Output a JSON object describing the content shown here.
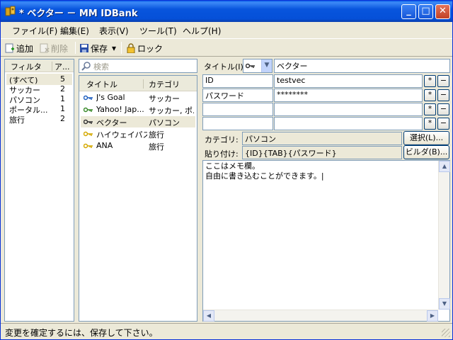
{
  "window": {
    "title": "* ベクター － MM IDBank",
    "minimize": "_",
    "maximize": "□",
    "close": "✕"
  },
  "menu": [
    {
      "label": "ファイル(F)"
    },
    {
      "label": "編集(E)"
    },
    {
      "label": "表示(V)"
    },
    {
      "label": "ツール(T)"
    },
    {
      "label": "ヘルプ(H)"
    }
  ],
  "toolbar": {
    "add": "追加",
    "delete": "削除",
    "save": "保存",
    "save_dropdown": "▾",
    "lock": "ロック"
  },
  "filter_panel": {
    "headers": [
      "フィルタ",
      "ア..."
    ],
    "rows": [
      {
        "name": "(すべて)",
        "count": "5"
      },
      {
        "name": "サッカー",
        "count": "2"
      },
      {
        "name": "パソコン",
        "count": "1"
      },
      {
        "name": "ポータル...",
        "count": "1"
      },
      {
        "name": "旅行",
        "count": "2"
      }
    ]
  },
  "search": {
    "placeholder": "検索"
  },
  "list_panel": {
    "headers": [
      "タイトル",
      "カテゴリ"
    ],
    "rows": [
      {
        "title": "J's Goal",
        "category": "サッカー",
        "key_color": "#1f5fbf"
      },
      {
        "title": "Yahoo! Jap...",
        "category": "サッカー, ポ...",
        "key_color": "#3a8a2a"
      },
      {
        "title": "ベクター",
        "category": "パソコン",
        "key_color": "#333333"
      },
      {
        "title": "ハイウェイパス",
        "category": "旅行",
        "key_color": "#d4a800"
      },
      {
        "title": "ANA",
        "category": "旅行",
        "key_color": "#d4a800"
      }
    ]
  },
  "detail": {
    "title_label": "タイトル(I):",
    "title_value": "ベクター",
    "fields": [
      {
        "name": "ID",
        "value": "testvec"
      },
      {
        "name": "パスワード",
        "value": "********"
      },
      {
        "name": "",
        "value": ""
      },
      {
        "name": "",
        "value": ""
      }
    ],
    "star": "*",
    "minus": "−",
    "category_label": "カテゴリ:",
    "category_value": "パソコン",
    "select_button": "選択(L)...",
    "paste_label": "貼り付け:",
    "paste_value": "{ID}{TAB}{パスワード}",
    "builder_button": "ビルダ(B)...",
    "memo": "ここはメモ欄。\n自由に書き込むことができます。|"
  },
  "status": "変更を確定するには、保存して下さい。"
}
